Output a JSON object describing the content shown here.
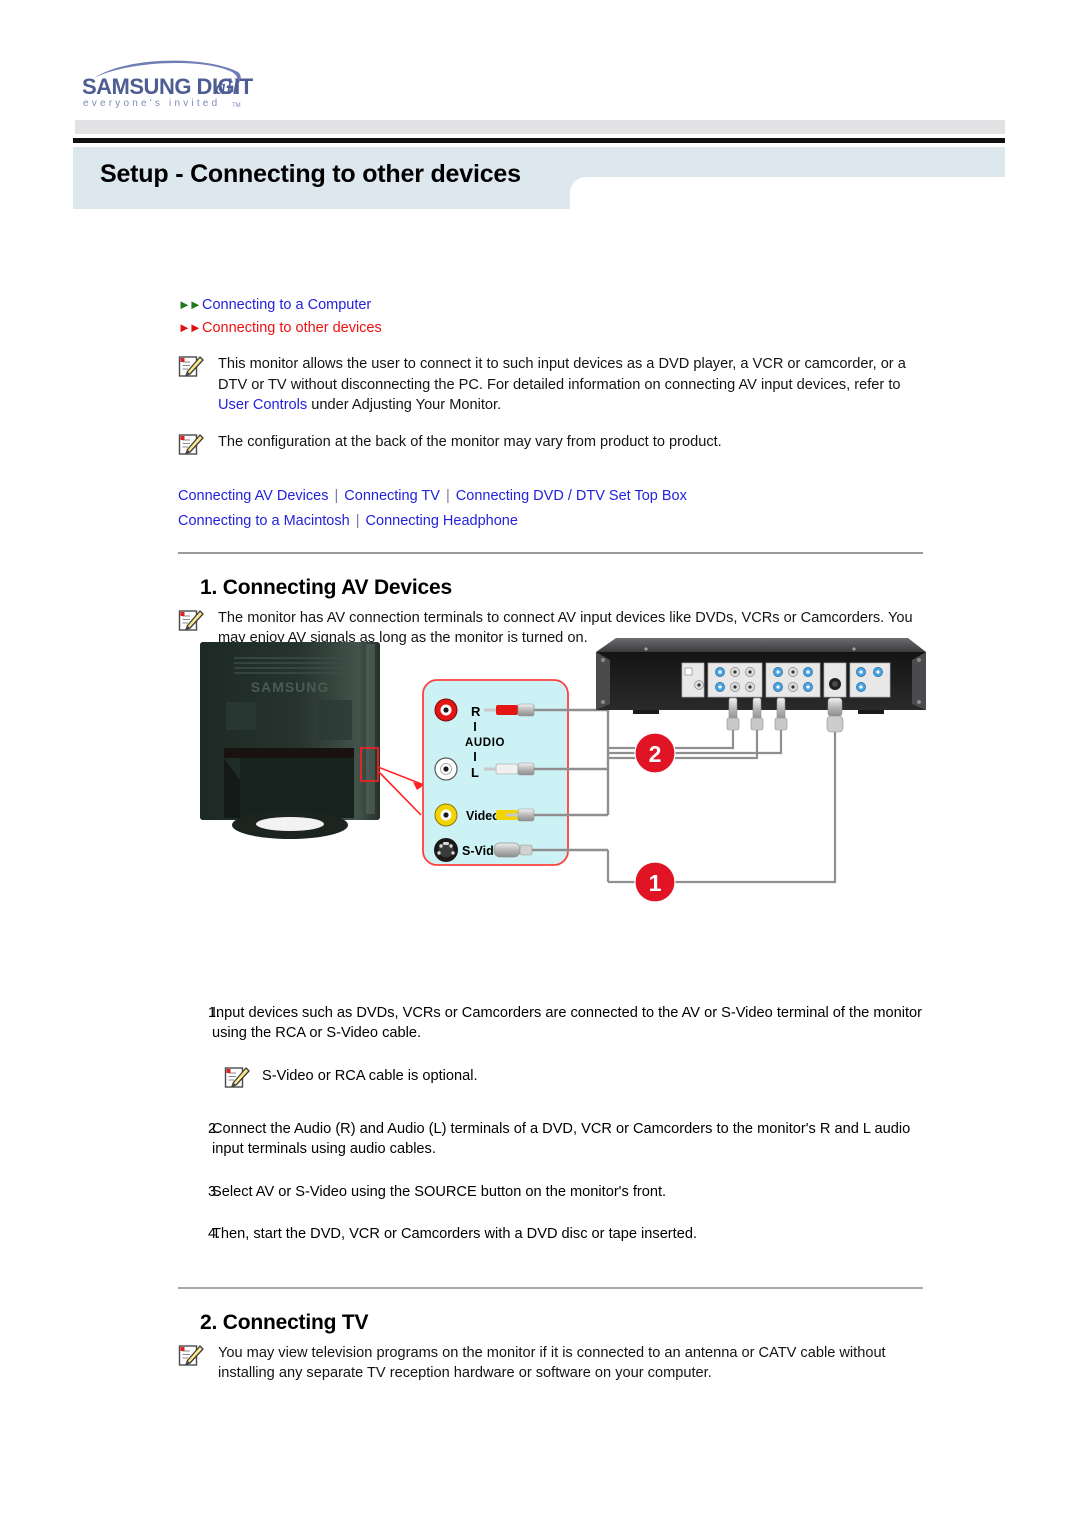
{
  "brand": {
    "logo_wordmark": "SAMSUNG DIGITall",
    "logo_tagline": "everyone's invited",
    "logo_tagline_tm": "TM",
    "logo_color": "#5b6ba6"
  },
  "header": {
    "title": "Setup - Connecting to other devices",
    "band_color": "#dde7ee",
    "rule_color": "#101010",
    "grey_color": "#e2e2e4"
  },
  "nav": {
    "items": [
      {
        "arrow_icon": "double-arrow-right-icon",
        "label": "Connecting to a Computer",
        "color": "#2222dd",
        "arrow_color": "#1f7a1f",
        "active": false
      },
      {
        "arrow_icon": "double-arrow-right-icon",
        "label": "Connecting to other devices",
        "color": "#ee1111",
        "arrow_color": "#e01010",
        "active": true
      }
    ]
  },
  "intro_notes": [
    {
      "icon": "notepad-pencil-icon",
      "text_before": "This monitor allows the user to connect it to such input devices as a DVD player, a VCR or camcorder, or a DTV or TV without disconnecting the PC. For detailed information on connecting AV input devices, refer to ",
      "link": "User Controls",
      "text_after": " under Adjusting Your Monitor."
    },
    {
      "icon": "notepad-pencil-icon",
      "text_before": "The configuration at the back of the monitor may vary from product to product.",
      "link": "",
      "text_after": ""
    }
  ],
  "linkbar": {
    "row1": [
      "Connecting AV Devices",
      "Connecting TV",
      "Connecting DVD / DTV Set Top Box"
    ],
    "row2": [
      "Connecting to a Macintosh",
      "Connecting Headphone"
    ],
    "separator": "|",
    "color": "#2222dd"
  },
  "section1": {
    "heading": "1. Connecting AV Devices",
    "note": {
      "icon": "notepad-pencil-icon",
      "text": "The monitor has AV connection terminals to connect AV input devices like DVDs, VCRs or Camcorders. You may enjoy AV signals as long as the monitor is turned on."
    },
    "steps": [
      {
        "num": "1.",
        "text": "Input devices such as DVDs, VCRs or Camcorders are connected to the AV or S-Video terminal of the monitor using the RCA or S-Video cable."
      },
      {
        "num": "2.",
        "text": "Connect the Audio (R) and Audio (L) terminals of a DVD, VCR or Camcorders to the monitor's R and L audio input terminals using audio cables."
      },
      {
        "num": "3.",
        "text": "Select AV or S-Video using the SOURCE button on the monitor's front."
      },
      {
        "num": "4.",
        "text": "Then, start the DVD, VCR or Camcorders with a DVD disc or tape inserted."
      }
    ],
    "substep_note": {
      "icon": "notepad-pencil-icon",
      "text": "S-Video or RCA cable is optional."
    }
  },
  "section2": {
    "heading": "2. Connecting TV",
    "note": {
      "icon": "notepad-pencil-icon",
      "text": "You may view television programs on the monitor if it is connected to an antenna or CATV cable without installing any separate TV reception hardware or software on your computer."
    }
  },
  "figure": {
    "name": "av-connection-diagram",
    "monitor_label": "SAMSUNG",
    "panel_bg": "#cdf2f5",
    "panel_border": "#ff3b3b",
    "jacks": [
      {
        "name": "audio-r-jack",
        "label": "R",
        "color": "#e31515"
      },
      {
        "name": "audio-label",
        "label": "AUDIO",
        "color": "#000000"
      },
      {
        "name": "audio-l-jack",
        "label": "L",
        "color": "#ffffff"
      },
      {
        "name": "video-jack",
        "label": "Video",
        "color": "#f2d406"
      },
      {
        "name": "s-video-jack",
        "label": "S-Video",
        "color": "#1a1a1a"
      }
    ],
    "callouts": [
      {
        "name": "callout-1",
        "label": "1",
        "color": "#e01424"
      },
      {
        "name": "callout-2",
        "label": "2",
        "color": "#e01424"
      }
    ]
  }
}
